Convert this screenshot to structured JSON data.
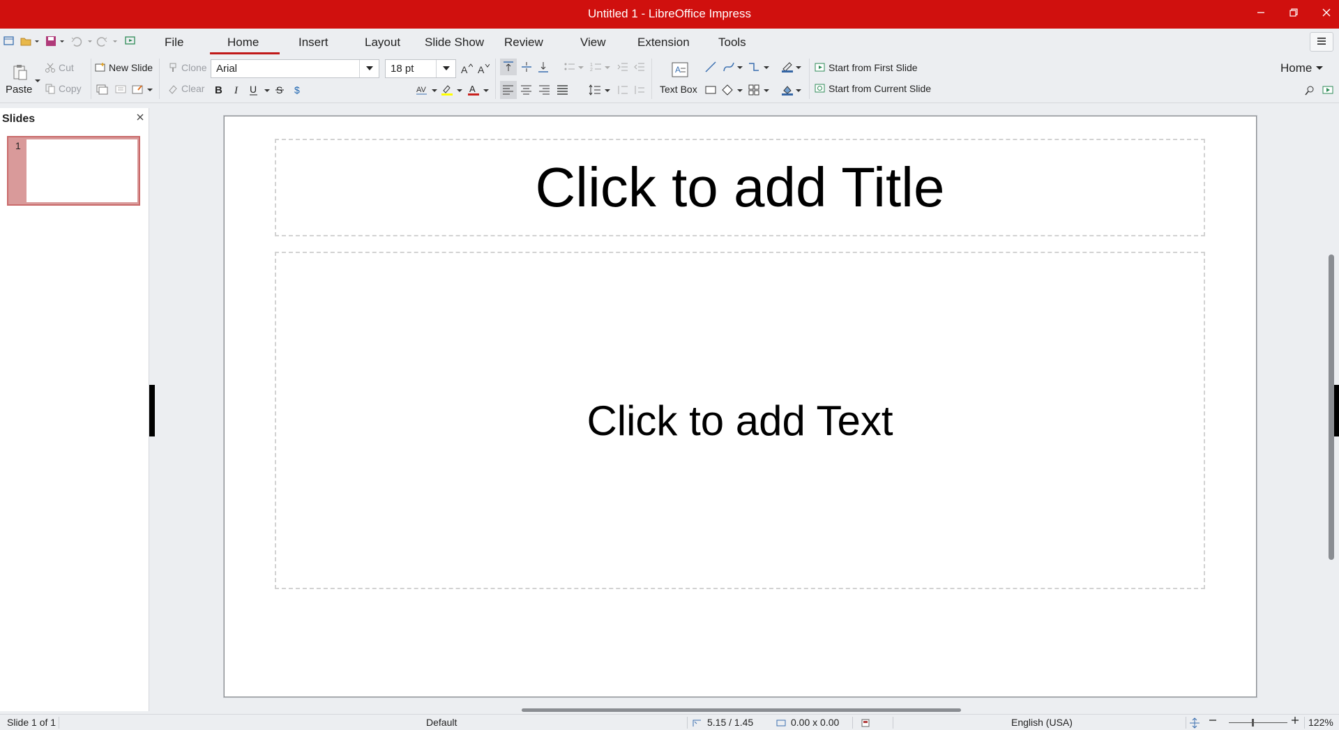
{
  "window": {
    "title": "Untitled 1 - LibreOffice Impress",
    "accent_color": "#d0100e"
  },
  "menubar": {
    "tabs": [
      "File",
      "Home",
      "Insert",
      "Layout",
      "Slide Show",
      "Review",
      "View",
      "Extension",
      "Tools"
    ],
    "active_tab": "Home"
  },
  "ribbon": {
    "paste": "Paste",
    "cut": "Cut",
    "copy": "Copy",
    "new_slide": "New Slide",
    "clone": "Clone",
    "clear": "Clear",
    "font_name": "Arial",
    "font_size": "18 pt",
    "text_box": "Text Box",
    "start_first": "Start from First Slide",
    "start_current": "Start from Current Slide",
    "home_dropdown": "Home"
  },
  "slides_pane": {
    "title": "Slides",
    "thumbnail_number": "1"
  },
  "slide": {
    "title_placeholder": "Click to add Title",
    "body_placeholder": "Click to add Text"
  },
  "statusbar": {
    "slide_info": "Slide 1 of 1",
    "master": "Default",
    "position": "5.15 / 1.45",
    "size": "0.00 x 0.00",
    "language": "English (USA)",
    "zoom": "122%"
  }
}
